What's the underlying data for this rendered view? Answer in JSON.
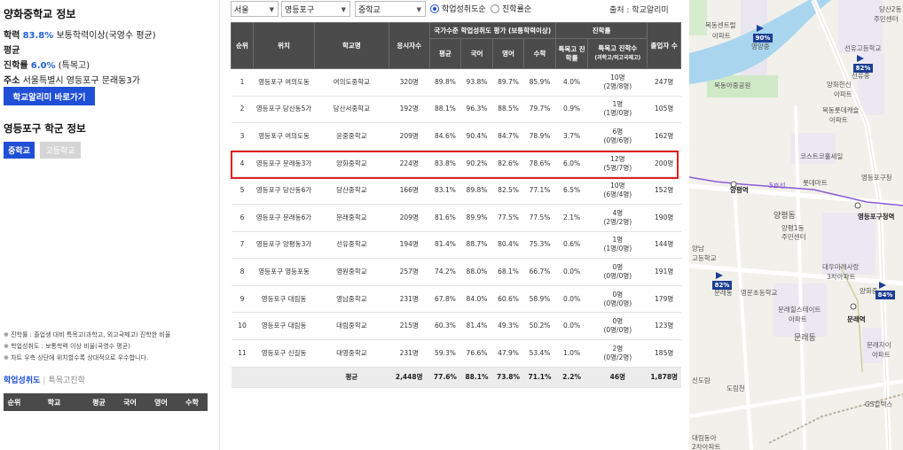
{
  "left": {
    "school_title": "양화중학교 정보",
    "achievement_label": "학력",
    "achievement_value": "83.8%",
    "achievement_note": "보통학력이상(국영수 평균)",
    "avg_label": "평균",
    "advance_label": "진학률",
    "advance_value": "6.0%",
    "advance_note": "(특목고)",
    "address_label": "주소",
    "address_value": "서울특별시 영등포구 문래동3가",
    "go_button": "학교알리미 바로가기",
    "district_title": "영등포구 학군 정보",
    "tab_middle": "중학교",
    "tab_high": "고등학교",
    "notes": [
      "※ 진학률 : 졸업생 대비 특목고(과학고, 외고국제고) 진학한 비율",
      "※ 학업성취도 : 보통학력 이상 비율(국영수 평균)",
      "※ 차트 우측 상단에 위치할수록 상대적으로 우수합니다."
    ],
    "mini_tab_a": "학업성취도",
    "mini_tab_b": "특목고진학",
    "mini_headers": [
      "순위",
      "학교",
      "평균",
      "국어",
      "영어",
      "수학"
    ]
  },
  "filters": {
    "city": "서울",
    "district": "영등포구",
    "level": "중학교",
    "radio_a": "학업성취도순",
    "radio_b": "진학률순",
    "source": "출처 : 학교알리미"
  },
  "table": {
    "h_rank": "순위",
    "h_loc": "위치",
    "h_school": "학교명",
    "h_students": "응시자수",
    "h_group_eval": "국가수준 학업성취도 평가 (보통학력이상)",
    "h_group_adv": "진학률",
    "h_avg": "평균",
    "h_kor": "국어",
    "h_eng": "영어",
    "h_math": "수학",
    "h_special_rate": "특목고 진학률",
    "h_special_count": "특목고 진학수",
    "h_special_count_sub": "(과학고/외고국제고)",
    "h_grads": "졸업자 수",
    "rows": [
      {
        "rank": "1",
        "loc": "영등포구 여의도동",
        "school": "여의도중학교",
        "students": "320명",
        "avg": "89.8%",
        "kor": "93.8%",
        "eng": "89.7%",
        "math": "85.9%",
        "rate": "4.0%",
        "cnt": "10명",
        "cnt_sub": "(2명/8명)",
        "grads": "247명"
      },
      {
        "rank": "2",
        "loc": "영등포구 당산동5가",
        "school": "당산서중학교",
        "students": "192명",
        "avg": "88.1%",
        "kor": "96.3%",
        "eng": "88.5%",
        "math": "79.7%",
        "rate": "0.9%",
        "cnt": "1명",
        "cnt_sub": "(1명/0명)",
        "grads": "105명"
      },
      {
        "rank": "3",
        "loc": "영등포구 여의도동",
        "school": "윤중중학교",
        "students": "209명",
        "avg": "84.6%",
        "kor": "90.4%",
        "eng": "84.7%",
        "math": "78.9%",
        "rate": "3.7%",
        "cnt": "6명",
        "cnt_sub": "(0명/6명)",
        "grads": "162명"
      },
      {
        "rank": "4",
        "loc": "영등포구 문래동3가",
        "school": "양화중학교",
        "students": "224명",
        "avg": "83.8%",
        "kor": "90.2%",
        "eng": "82.6%",
        "math": "78.6%",
        "rate": "6.0%",
        "cnt": "12명",
        "cnt_sub": "(5명/7명)",
        "grads": "200명"
      },
      {
        "rank": "5",
        "loc": "영등포구 당산동6가",
        "school": "당산중학교",
        "students": "166명",
        "avg": "83.1%",
        "kor": "89.8%",
        "eng": "82.5%",
        "math": "77.1%",
        "rate": "6.5%",
        "cnt": "10명",
        "cnt_sub": "(6명/4명)",
        "grads": "152명"
      },
      {
        "rank": "6",
        "loc": "영등포구 문래동6가",
        "school": "문래중학교",
        "students": "209명",
        "avg": "81.6%",
        "kor": "89.9%",
        "eng": "77.5%",
        "math": "77.5%",
        "rate": "2.1%",
        "cnt": "4명",
        "cnt_sub": "(2명/2명)",
        "grads": "190명"
      },
      {
        "rank": "7",
        "loc": "영등포구 양평동3가",
        "school": "선유중학교",
        "students": "194명",
        "avg": "81.4%",
        "kor": "88.7%",
        "eng": "80.4%",
        "math": "75.3%",
        "rate": "0.6%",
        "cnt": "1명",
        "cnt_sub": "(1명/0명)",
        "grads": "144명"
      },
      {
        "rank": "8",
        "loc": "영등포구 영등포동",
        "school": "영원중학교",
        "students": "257명",
        "avg": "74.2%",
        "kor": "88.0%",
        "eng": "68.1%",
        "math": "66.7%",
        "rate": "0.0%",
        "cnt": "0명",
        "cnt_sub": "(0명/0명)",
        "grads": "191명"
      },
      {
        "rank": "9",
        "loc": "영등포구 대림동",
        "school": "영남중학교",
        "students": "231명",
        "avg": "67.8%",
        "kor": "84.0%",
        "eng": "60.6%",
        "math": "58.9%",
        "rate": "0.0%",
        "cnt": "0명",
        "cnt_sub": "(0명/0명)",
        "grads": "179명"
      },
      {
        "rank": "10",
        "loc": "영등포구 대림동",
        "school": "대림중학교",
        "students": "215명",
        "avg": "60.3%",
        "kor": "81.4%",
        "eng": "49.3%",
        "math": "50.2%",
        "rate": "0.0%",
        "cnt": "0명",
        "cnt_sub": "(0명/0명)",
        "grads": "123명"
      },
      {
        "rank": "11",
        "loc": "영등포구 신길동",
        "school": "대영중학교",
        "students": "231명",
        "avg": "59.3%",
        "kor": "76.6%",
        "eng": "47.9%",
        "math": "53.4%",
        "rate": "1.0%",
        "cnt": "2명",
        "cnt_sub": "(0명/2명)",
        "grads": "185명"
      }
    ],
    "avg_row": {
      "label": "평균",
      "students": "2,448명",
      "avg": "77.6%",
      "kor": "88.1%",
      "eng": "73.8%",
      "math": "71.1%",
      "rate": "2.2%",
      "cnt": "46명",
      "grads": "1,878명"
    }
  },
  "map": {
    "labels": [
      "목동센트럴",
      "아파트",
      "영양중",
      "목동아중공원",
      "선유고등학교",
      "당산2동",
      "주민센터",
      "양화한신",
      "아파트",
      "목동롯데캐슬",
      "아파트",
      "선유중",
      "코스트코홀세일",
      "롯데마트",
      "영등포구청",
      "영등포구청역",
      "양평동",
      "양평1동",
      "주민센터",
      "양평역",
      "양남",
      "고등학교",
      "문래동",
      "영문초등학교",
      "대우미래사랑",
      "3차아파트",
      "문래힐스테이트",
      "아파트",
      "문래동",
      "문래역",
      "양화중",
      "신도림",
      "도림천",
      "GS칼텍스",
      "대림동아",
      "2차아파트",
      "문래자이",
      "아파트"
    ],
    "badges": [
      "90%",
      "82%",
      "82%",
      "84%"
    ],
    "line_label": "5호선"
  }
}
